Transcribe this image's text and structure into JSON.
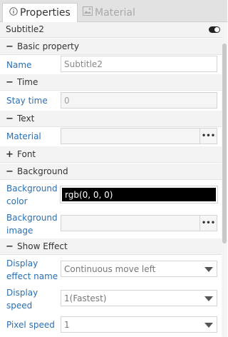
{
  "tabs": [
    {
      "label": "Properties",
      "icon": "info-icon",
      "active": true
    },
    {
      "label": "Material",
      "icon": "image-icon",
      "active": false
    }
  ],
  "header": {
    "title": "Subtitle2",
    "toggle_on": true
  },
  "sections": {
    "basic": "Basic property",
    "time": "Time",
    "text": "Text",
    "font": "Font",
    "background": "Background",
    "show_effect": "Show Effect"
  },
  "fields": {
    "name_label": "Name",
    "name_value": "Subtitle2",
    "stay_time_label": "Stay time",
    "stay_time_value": "0",
    "material_label": "Material",
    "material_value": "",
    "bg_color_label_1": "Background",
    "bg_color_label_2": "color",
    "bg_color_value": "rgb(0, 0, 0)",
    "bg_image_label_1": "Background",
    "bg_image_label_2": "image",
    "bg_image_value": "",
    "display_effect_label_1": "Display",
    "display_effect_label_2": "effect name",
    "display_effect_value": "Continuous move left",
    "display_speed_label_1": "Display",
    "display_speed_label_2": "speed",
    "display_speed_value": "1(Fastest)",
    "pixel_speed_label": "Pixel speed",
    "pixel_speed_value": "1"
  },
  "buttons": {
    "browse": "•••"
  },
  "colors": {
    "label": "#2a6fb3",
    "section_bg": "#f3f3f3",
    "bg_color_swatch": "#000000"
  }
}
